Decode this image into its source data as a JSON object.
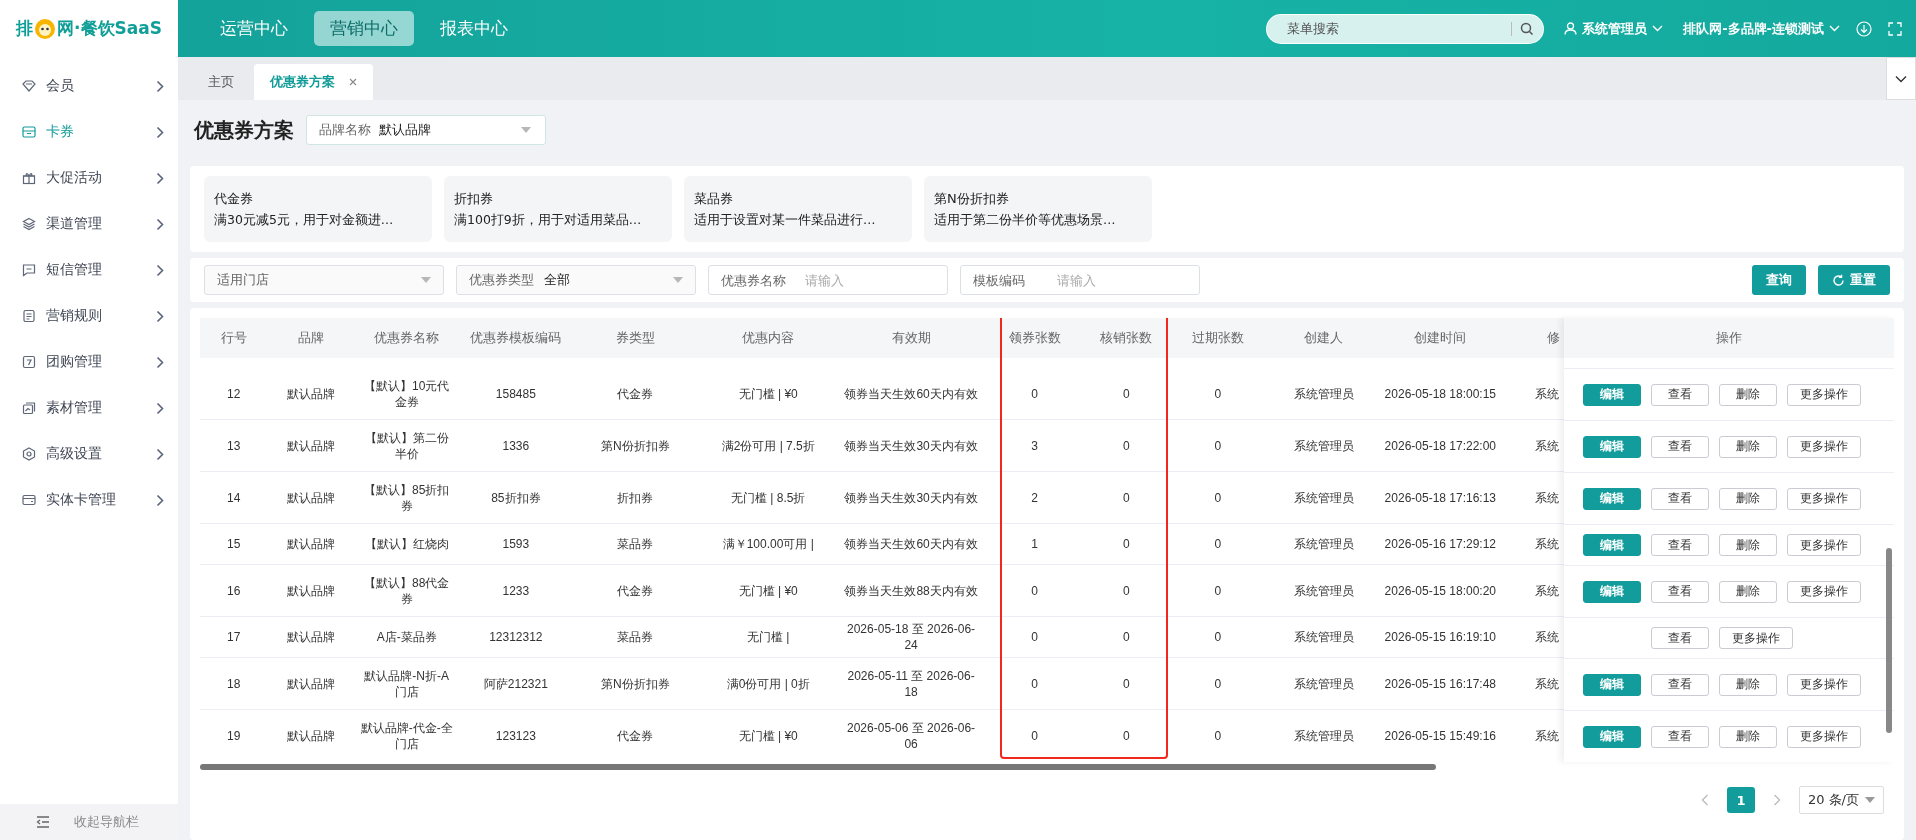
{
  "logo": {
    "text_before": "排",
    "text_after": "网·餐饮SaaS"
  },
  "top_nav": [
    {
      "label": "运营中心",
      "selected": false
    },
    {
      "label": "营销中心",
      "selected": true
    },
    {
      "label": "报表中心",
      "selected": false
    }
  ],
  "search": {
    "placeholder": "菜单搜索"
  },
  "user": {
    "name": "系统管理员",
    "org": "排队网-多品牌-连锁测试"
  },
  "sidebar": {
    "items": [
      {
        "label": "会员",
        "selected": false
      },
      {
        "label": "卡券",
        "selected": true
      },
      {
        "label": "大促活动",
        "selected": false
      },
      {
        "label": "渠道管理",
        "selected": false
      },
      {
        "label": "短信管理",
        "selected": false
      },
      {
        "label": "营销规则",
        "selected": false
      },
      {
        "label": "团购管理",
        "selected": false
      },
      {
        "label": "素材管理",
        "selected": false
      },
      {
        "label": "高级设置",
        "selected": false
      },
      {
        "label": "实体卡管理",
        "selected": false
      }
    ],
    "collapse_label": "收起导航栏"
  },
  "tabs": [
    {
      "label": "主页",
      "selected": false,
      "closable": false
    },
    {
      "label": "优惠券方案",
      "selected": true,
      "closable": true
    }
  ],
  "page_title": "优惠券方案",
  "brand_select": {
    "label": "品牌名称",
    "value": "默认品牌"
  },
  "coupon_types": [
    {
      "title": "代金券",
      "desc": "满30元减5元，用于对金额进…"
    },
    {
      "title": "折扣券",
      "desc": "满100打9折，用于对适用菜品…"
    },
    {
      "title": "菜品券",
      "desc": "适用于设置对某一件菜品进行…"
    },
    {
      "title": "第N份折扣券",
      "desc": "适用于第二份半价等优惠场景…"
    }
  ],
  "filters": [
    {
      "kind": "select",
      "label": "适用门店"
    },
    {
      "kind": "select",
      "label": "优惠券类型",
      "value": "全部"
    },
    {
      "kind": "input",
      "label": "优惠券名称",
      "placeholder": "请输入"
    },
    {
      "kind": "input",
      "label": "模板编码",
      "placeholder": "请输入"
    }
  ],
  "buttons": {
    "query": "查询",
    "reset": "重置"
  },
  "table": {
    "columns": [
      "行号",
      "品牌",
      "优惠券名称",
      "优惠券模板编码",
      "券类型",
      "优惠内容",
      "有效期",
      "领券张数",
      "核销张数",
      "过期张数",
      "创建人",
      "创建时间",
      "修"
    ],
    "action_column": "操作",
    "rows": [
      {
        "cells": [
          "12",
          "默认品牌",
          "【默认】10元代金券",
          "158485",
          "代金券",
          "无门槛 | ¥0",
          "领券当天生效60天内有效",
          "0",
          "0",
          "0",
          "系统管理员",
          "2026-05-18 18:00:15",
          "系统"
        ],
        "actions": [
          {
            "label": "编辑",
            "kind": "primary"
          },
          {
            "label": "查看",
            "kind": "default"
          },
          {
            "label": "删除",
            "kind": "default"
          },
          {
            "label": "更多操作",
            "kind": "default"
          }
        ]
      },
      {
        "cells": [
          "13",
          "默认品牌",
          "【默认】第二份半价",
          "1336",
          "第N份折扣券",
          "满2份可用 | 7.5折",
          "领券当天生效30天内有效",
          "3",
          "0",
          "0",
          "系统管理员",
          "2026-05-18 17:22:00",
          "系统"
        ],
        "actions": [
          {
            "label": "编辑",
            "kind": "primary"
          },
          {
            "label": "查看",
            "kind": "default"
          },
          {
            "label": "删除",
            "kind": "default"
          },
          {
            "label": "更多操作",
            "kind": "default"
          }
        ]
      },
      {
        "cells": [
          "14",
          "默认品牌",
          "【默认】85折扣券",
          "85折扣券",
          "折扣券",
          "无门槛 | 8.5折",
          "领券当天生效30天内有效",
          "2",
          "0",
          "0",
          "系统管理员",
          "2026-05-18 17:16:13",
          "系统"
        ],
        "actions": [
          {
            "label": "编辑",
            "kind": "primary"
          },
          {
            "label": "查看",
            "kind": "default"
          },
          {
            "label": "删除",
            "kind": "default"
          },
          {
            "label": "更多操作",
            "kind": "default"
          }
        ]
      },
      {
        "cells": [
          "15",
          "默认品牌",
          "【默认】红烧肉",
          "1593",
          "菜品券",
          "满￥100.00可用 |",
          "领券当天生效60天内有效",
          "1",
          "0",
          "0",
          "系统管理员",
          "2026-05-16 17:29:12",
          "系统"
        ],
        "actions": [
          {
            "label": "编辑",
            "kind": "primary"
          },
          {
            "label": "查看",
            "kind": "default"
          },
          {
            "label": "删除",
            "kind": "default"
          },
          {
            "label": "更多操作",
            "kind": "default"
          }
        ]
      },
      {
        "cells": [
          "16",
          "默认品牌",
          "【默认】88代金券",
          "1233",
          "代金券",
          "无门槛 | ¥0",
          "领券当天生效88天内有效",
          "0",
          "0",
          "0",
          "系统管理员",
          "2026-05-15 18:00:20",
          "系统"
        ],
        "actions": [
          {
            "label": "编辑",
            "kind": "primary"
          },
          {
            "label": "查看",
            "kind": "default"
          },
          {
            "label": "删除",
            "kind": "default"
          },
          {
            "label": "更多操作",
            "kind": "default"
          }
        ]
      },
      {
        "cells": [
          "17",
          "默认品牌",
          "A店-菜品券",
          "12312312",
          "菜品券",
          "无门槛 |",
          "2026-05-18 至 2026-06-24",
          "0",
          "0",
          "0",
          "系统管理员",
          "2026-05-15 16:19:10",
          "系统"
        ],
        "actions": [
          {
            "label": "查看",
            "kind": "default"
          },
          {
            "label": "更多操作",
            "kind": "default"
          }
        ]
      },
      {
        "cells": [
          "18",
          "默认品牌",
          "默认品牌-N折-A门店",
          "阿萨212321",
          "第N份折扣券",
          "满0份可用 | 0折",
          "2026-05-11 至 2026-06-18",
          "0",
          "0",
          "0",
          "系统管理员",
          "2026-05-15 16:17:48",
          "系统"
        ],
        "actions": [
          {
            "label": "编辑",
            "kind": "primary"
          },
          {
            "label": "查看",
            "kind": "default"
          },
          {
            "label": "删除",
            "kind": "default"
          },
          {
            "label": "更多操作",
            "kind": "default"
          }
        ]
      },
      {
        "cells": [
          "19",
          "默认品牌",
          "默认品牌-代金-全门店",
          "123123",
          "代金券",
          "无门槛 | ¥0",
          "2026-05-06 至 2026-06-06",
          "0",
          "0",
          "0",
          "系统管理员",
          "2026-05-15 15:49:16",
          "系统"
        ],
        "actions": [
          {
            "label": "编辑",
            "kind": "primary"
          },
          {
            "label": "查看",
            "kind": "default"
          },
          {
            "label": "删除",
            "kind": "default"
          },
          {
            "label": "更多操作",
            "kind": "default"
          }
        ]
      }
    ]
  },
  "pagination": {
    "pages": [
      {
        "label": "1",
        "selected": true
      }
    ],
    "page_size": "20 条/页"
  }
}
